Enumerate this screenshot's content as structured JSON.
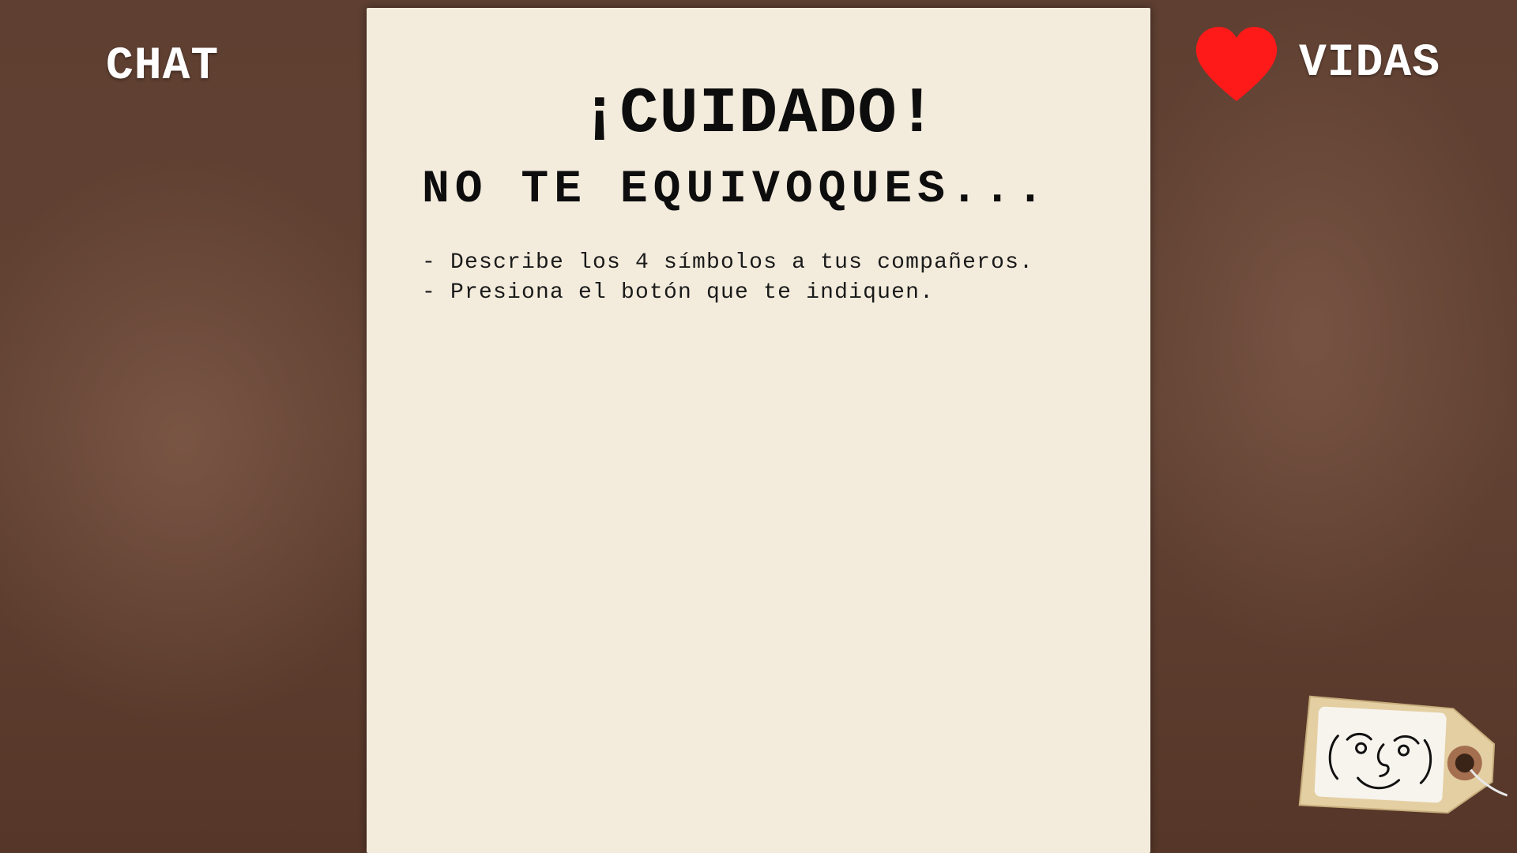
{
  "hud": {
    "chat_label": "CHAT",
    "lives_label": "VIDAS",
    "heart_color": "#ff1a1a",
    "heart_icon": "heart-icon"
  },
  "paper": {
    "title": "¡CUIDADO!",
    "subtitle": "NO TE EQUIVOQUES...",
    "instructions": [
      "- Describe los 4 símbolos a tus compañeros.",
      "- Presiona el botón que te indiquen."
    ]
  },
  "tag": {
    "icon": "lenny-face-icon"
  },
  "colors": {
    "background": "#5e3f31",
    "paper": "#f3ecdd",
    "text_dark": "#0d0d0d",
    "hud_text": "#ffffff"
  }
}
